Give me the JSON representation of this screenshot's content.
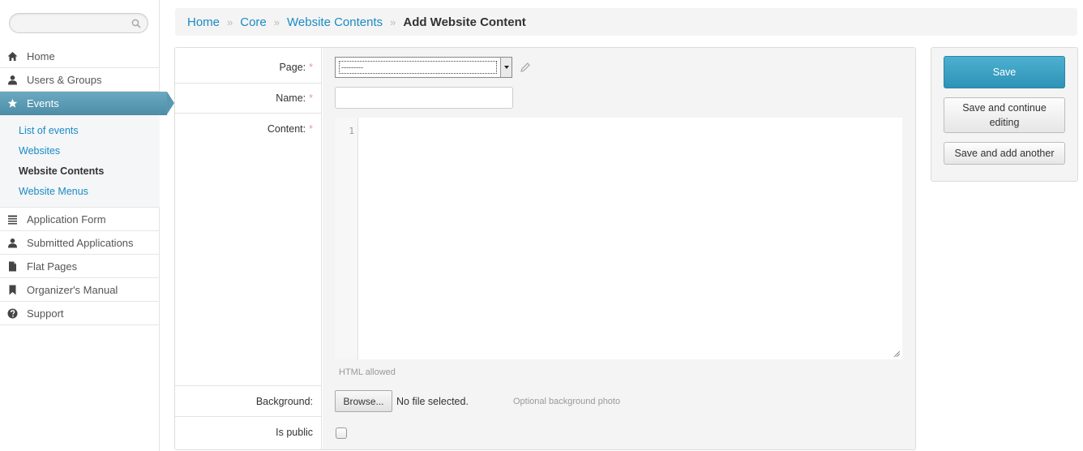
{
  "sidebar": {
    "search_placeholder": "",
    "nav": [
      {
        "label": "Home",
        "icon": "home-icon"
      },
      {
        "label": "Users & Groups",
        "icon": "user-icon"
      },
      {
        "label": "Events",
        "icon": "star-icon",
        "active": true
      }
    ],
    "subnav": [
      {
        "label": "List of events"
      },
      {
        "label": "Websites"
      },
      {
        "label": "Website Contents",
        "current": true
      },
      {
        "label": "Website Menus"
      }
    ],
    "nav_bottom": [
      {
        "label": "Application Form",
        "icon": "list-icon"
      },
      {
        "label": "Submitted Applications",
        "icon": "user-icon"
      },
      {
        "label": "Flat Pages",
        "icon": "document-icon"
      },
      {
        "label": "Organizer's Manual",
        "icon": "bookmark-icon"
      },
      {
        "label": "Support",
        "icon": "help-icon"
      }
    ]
  },
  "breadcrumb": {
    "items": [
      "Home",
      "Core",
      "Website Contents"
    ],
    "separator": "»",
    "current": "Add Website Content"
  },
  "form": {
    "page_label": "Page:",
    "page_value": "---------",
    "name_label": "Name:",
    "name_value": "",
    "content_label": "Content:",
    "content_line_number": "1",
    "content_help": "HTML allowed",
    "background_label": "Background:",
    "browse_label": "Browse...",
    "no_file_text": "No file selected.",
    "background_help": "Optional background photo",
    "is_public_label": "Is public",
    "is_public_checked": false,
    "required_marker": "*"
  },
  "actions": {
    "save": "Save",
    "save_continue": "Save and continue editing",
    "save_another": "Save and add another"
  },
  "colors": {
    "accent": "#1a8bc4",
    "active_nav": "#5b9fb7",
    "save_button": "#3aa1c3"
  }
}
